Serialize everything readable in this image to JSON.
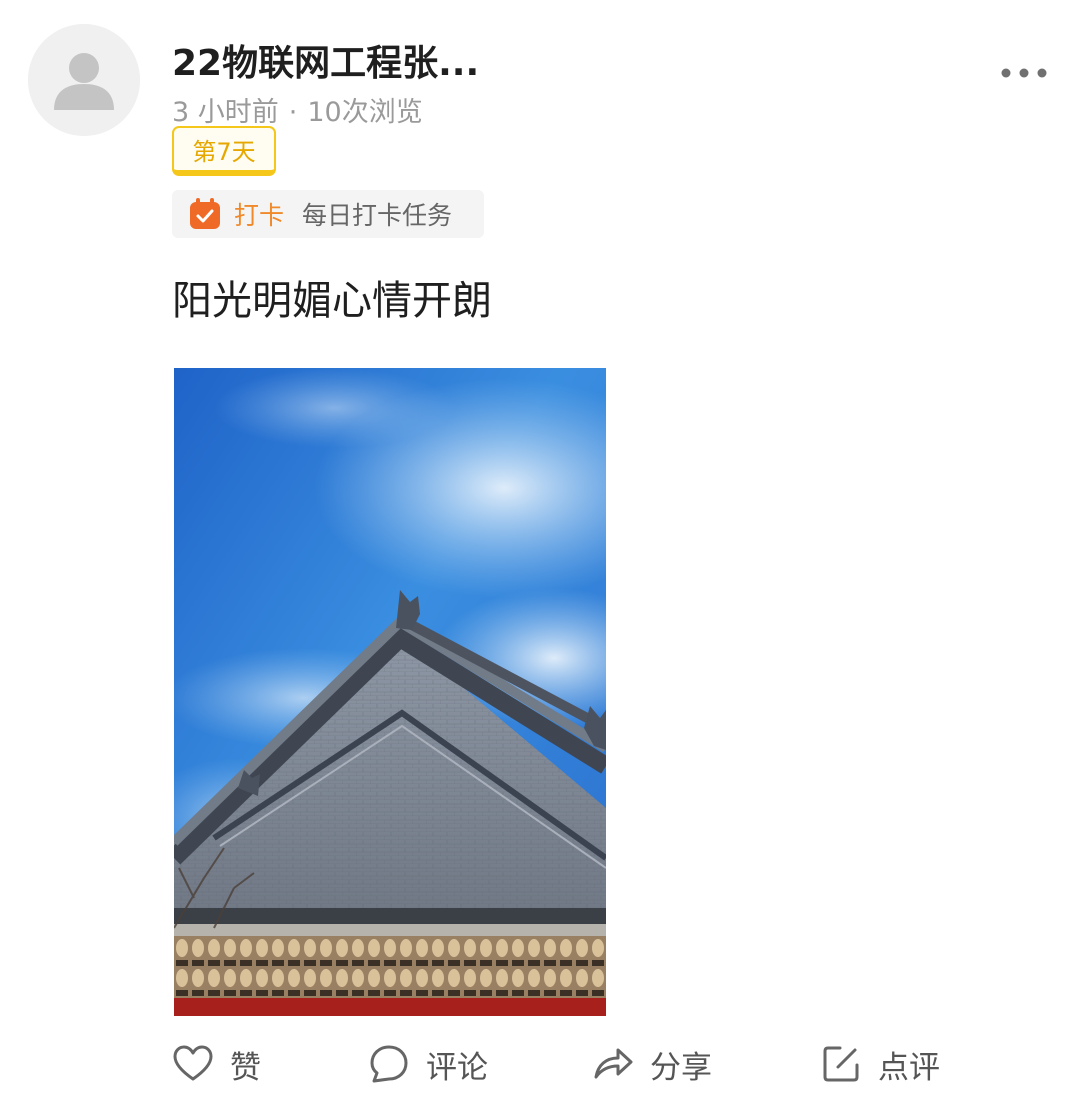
{
  "author": {
    "name": "22物联网工程张...",
    "avatar_icon": "default-user-avatar-icon"
  },
  "meta": {
    "time": "3 小时前",
    "separator": "·",
    "views": "10次浏览"
  },
  "badge": {
    "day_label": "第7天",
    "border_color": "#f6c71b",
    "text_color": "#e6a800"
  },
  "checkin": {
    "icon": "calendar-check-icon",
    "tag": "打卡",
    "task": "每日打卡任务",
    "accent": "#f0892a"
  },
  "post": {
    "text": "阳光明媚心情开朗",
    "image_icon": "photo-blue-sky-traditional-roof"
  },
  "actions": [
    {
      "icon": "heart-icon",
      "label": "赞"
    },
    {
      "icon": "comment-bubble-icon",
      "label": "评论"
    },
    {
      "icon": "share-arrow-icon",
      "label": "分享"
    },
    {
      "icon": "edit-icon",
      "label": "点评"
    }
  ],
  "menu": {
    "icon": "more-dots-icon"
  }
}
